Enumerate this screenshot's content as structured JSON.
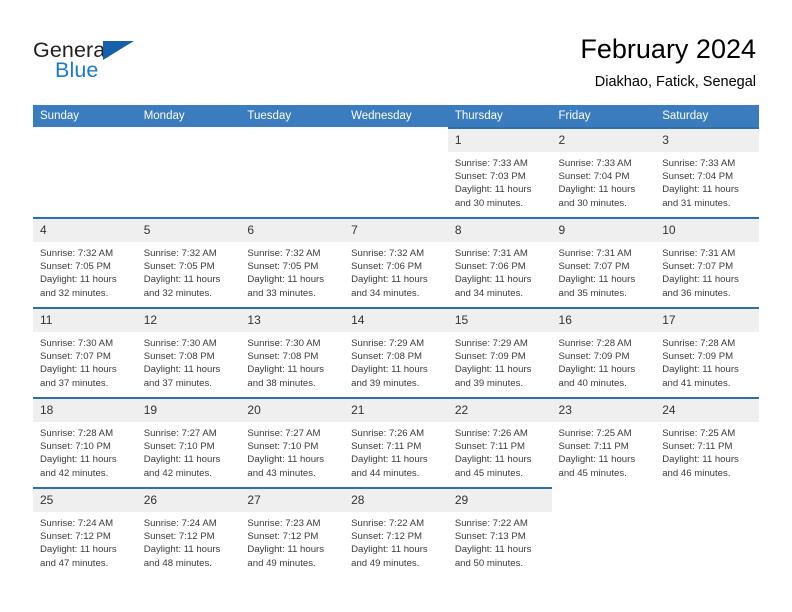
{
  "brand": {
    "name_part1": "General",
    "name_part2": "Blue",
    "triangle_icon": "triangle-icon",
    "color_dark": "#231f20",
    "color_blue": "#1a7bc4"
  },
  "header": {
    "title": "February 2024",
    "subtitle": "Diakhao, Fatick, Senegal"
  },
  "theme": {
    "header_row_bg": "#3a7cbe",
    "row_divider": "#2f6fb0",
    "daynum_bg": "#efefef"
  },
  "weekday_headers": [
    "Sunday",
    "Monday",
    "Tuesday",
    "Wednesday",
    "Thursday",
    "Friday",
    "Saturday"
  ],
  "weeks": [
    [
      {
        "day": "",
        "empty": true
      },
      {
        "day": "",
        "empty": true
      },
      {
        "day": "",
        "empty": true
      },
      {
        "day": "",
        "empty": true
      },
      {
        "day": "1",
        "sunrise": "Sunrise: 7:33 AM",
        "sunset": "Sunset: 7:03 PM",
        "daylight1": "Daylight: 11 hours",
        "daylight2": "and 30 minutes."
      },
      {
        "day": "2",
        "sunrise": "Sunrise: 7:33 AM",
        "sunset": "Sunset: 7:04 PM",
        "daylight1": "Daylight: 11 hours",
        "daylight2": "and 30 minutes."
      },
      {
        "day": "3",
        "sunrise": "Sunrise: 7:33 AM",
        "sunset": "Sunset: 7:04 PM",
        "daylight1": "Daylight: 11 hours",
        "daylight2": "and 31 minutes."
      }
    ],
    [
      {
        "day": "4",
        "sunrise": "Sunrise: 7:32 AM",
        "sunset": "Sunset: 7:05 PM",
        "daylight1": "Daylight: 11 hours",
        "daylight2": "and 32 minutes."
      },
      {
        "day": "5",
        "sunrise": "Sunrise: 7:32 AM",
        "sunset": "Sunset: 7:05 PM",
        "daylight1": "Daylight: 11 hours",
        "daylight2": "and 32 minutes."
      },
      {
        "day": "6",
        "sunrise": "Sunrise: 7:32 AM",
        "sunset": "Sunset: 7:05 PM",
        "daylight1": "Daylight: 11 hours",
        "daylight2": "and 33 minutes."
      },
      {
        "day": "7",
        "sunrise": "Sunrise: 7:32 AM",
        "sunset": "Sunset: 7:06 PM",
        "daylight1": "Daylight: 11 hours",
        "daylight2": "and 34 minutes."
      },
      {
        "day": "8",
        "sunrise": "Sunrise: 7:31 AM",
        "sunset": "Sunset: 7:06 PM",
        "daylight1": "Daylight: 11 hours",
        "daylight2": "and 34 minutes."
      },
      {
        "day": "9",
        "sunrise": "Sunrise: 7:31 AM",
        "sunset": "Sunset: 7:07 PM",
        "daylight1": "Daylight: 11 hours",
        "daylight2": "and 35 minutes."
      },
      {
        "day": "10",
        "sunrise": "Sunrise: 7:31 AM",
        "sunset": "Sunset: 7:07 PM",
        "daylight1": "Daylight: 11 hours",
        "daylight2": "and 36 minutes."
      }
    ],
    [
      {
        "day": "11",
        "sunrise": "Sunrise: 7:30 AM",
        "sunset": "Sunset: 7:07 PM",
        "daylight1": "Daylight: 11 hours",
        "daylight2": "and 37 minutes."
      },
      {
        "day": "12",
        "sunrise": "Sunrise: 7:30 AM",
        "sunset": "Sunset: 7:08 PM",
        "daylight1": "Daylight: 11 hours",
        "daylight2": "and 37 minutes."
      },
      {
        "day": "13",
        "sunrise": "Sunrise: 7:30 AM",
        "sunset": "Sunset: 7:08 PM",
        "daylight1": "Daylight: 11 hours",
        "daylight2": "and 38 minutes."
      },
      {
        "day": "14",
        "sunrise": "Sunrise: 7:29 AM",
        "sunset": "Sunset: 7:08 PM",
        "daylight1": "Daylight: 11 hours",
        "daylight2": "and 39 minutes."
      },
      {
        "day": "15",
        "sunrise": "Sunrise: 7:29 AM",
        "sunset": "Sunset: 7:09 PM",
        "daylight1": "Daylight: 11 hours",
        "daylight2": "and 39 minutes."
      },
      {
        "day": "16",
        "sunrise": "Sunrise: 7:28 AM",
        "sunset": "Sunset: 7:09 PM",
        "daylight1": "Daylight: 11 hours",
        "daylight2": "and 40 minutes."
      },
      {
        "day": "17",
        "sunrise": "Sunrise: 7:28 AM",
        "sunset": "Sunset: 7:09 PM",
        "daylight1": "Daylight: 11 hours",
        "daylight2": "and 41 minutes."
      }
    ],
    [
      {
        "day": "18",
        "sunrise": "Sunrise: 7:28 AM",
        "sunset": "Sunset: 7:10 PM",
        "daylight1": "Daylight: 11 hours",
        "daylight2": "and 42 minutes."
      },
      {
        "day": "19",
        "sunrise": "Sunrise: 7:27 AM",
        "sunset": "Sunset: 7:10 PM",
        "daylight1": "Daylight: 11 hours",
        "daylight2": "and 42 minutes."
      },
      {
        "day": "20",
        "sunrise": "Sunrise: 7:27 AM",
        "sunset": "Sunset: 7:10 PM",
        "daylight1": "Daylight: 11 hours",
        "daylight2": "and 43 minutes."
      },
      {
        "day": "21",
        "sunrise": "Sunrise: 7:26 AM",
        "sunset": "Sunset: 7:11 PM",
        "daylight1": "Daylight: 11 hours",
        "daylight2": "and 44 minutes."
      },
      {
        "day": "22",
        "sunrise": "Sunrise: 7:26 AM",
        "sunset": "Sunset: 7:11 PM",
        "daylight1": "Daylight: 11 hours",
        "daylight2": "and 45 minutes."
      },
      {
        "day": "23",
        "sunrise": "Sunrise: 7:25 AM",
        "sunset": "Sunset: 7:11 PM",
        "daylight1": "Daylight: 11 hours",
        "daylight2": "and 45 minutes."
      },
      {
        "day": "24",
        "sunrise": "Sunrise: 7:25 AM",
        "sunset": "Sunset: 7:11 PM",
        "daylight1": "Daylight: 11 hours",
        "daylight2": "and 46 minutes."
      }
    ],
    [
      {
        "day": "25",
        "sunrise": "Sunrise: 7:24 AM",
        "sunset": "Sunset: 7:12 PM",
        "daylight1": "Daylight: 11 hours",
        "daylight2": "and 47 minutes."
      },
      {
        "day": "26",
        "sunrise": "Sunrise: 7:24 AM",
        "sunset": "Sunset: 7:12 PM",
        "daylight1": "Daylight: 11 hours",
        "daylight2": "and 48 minutes."
      },
      {
        "day": "27",
        "sunrise": "Sunrise: 7:23 AM",
        "sunset": "Sunset: 7:12 PM",
        "daylight1": "Daylight: 11 hours",
        "daylight2": "and 49 minutes."
      },
      {
        "day": "28",
        "sunrise": "Sunrise: 7:22 AM",
        "sunset": "Sunset: 7:12 PM",
        "daylight1": "Daylight: 11 hours",
        "daylight2": "and 49 minutes."
      },
      {
        "day": "29",
        "sunrise": "Sunrise: 7:22 AM",
        "sunset": "Sunset: 7:13 PM",
        "daylight1": "Daylight: 11 hours",
        "daylight2": "and 50 minutes."
      },
      {
        "day": "",
        "empty": true
      },
      {
        "day": "",
        "empty": true
      }
    ]
  ]
}
